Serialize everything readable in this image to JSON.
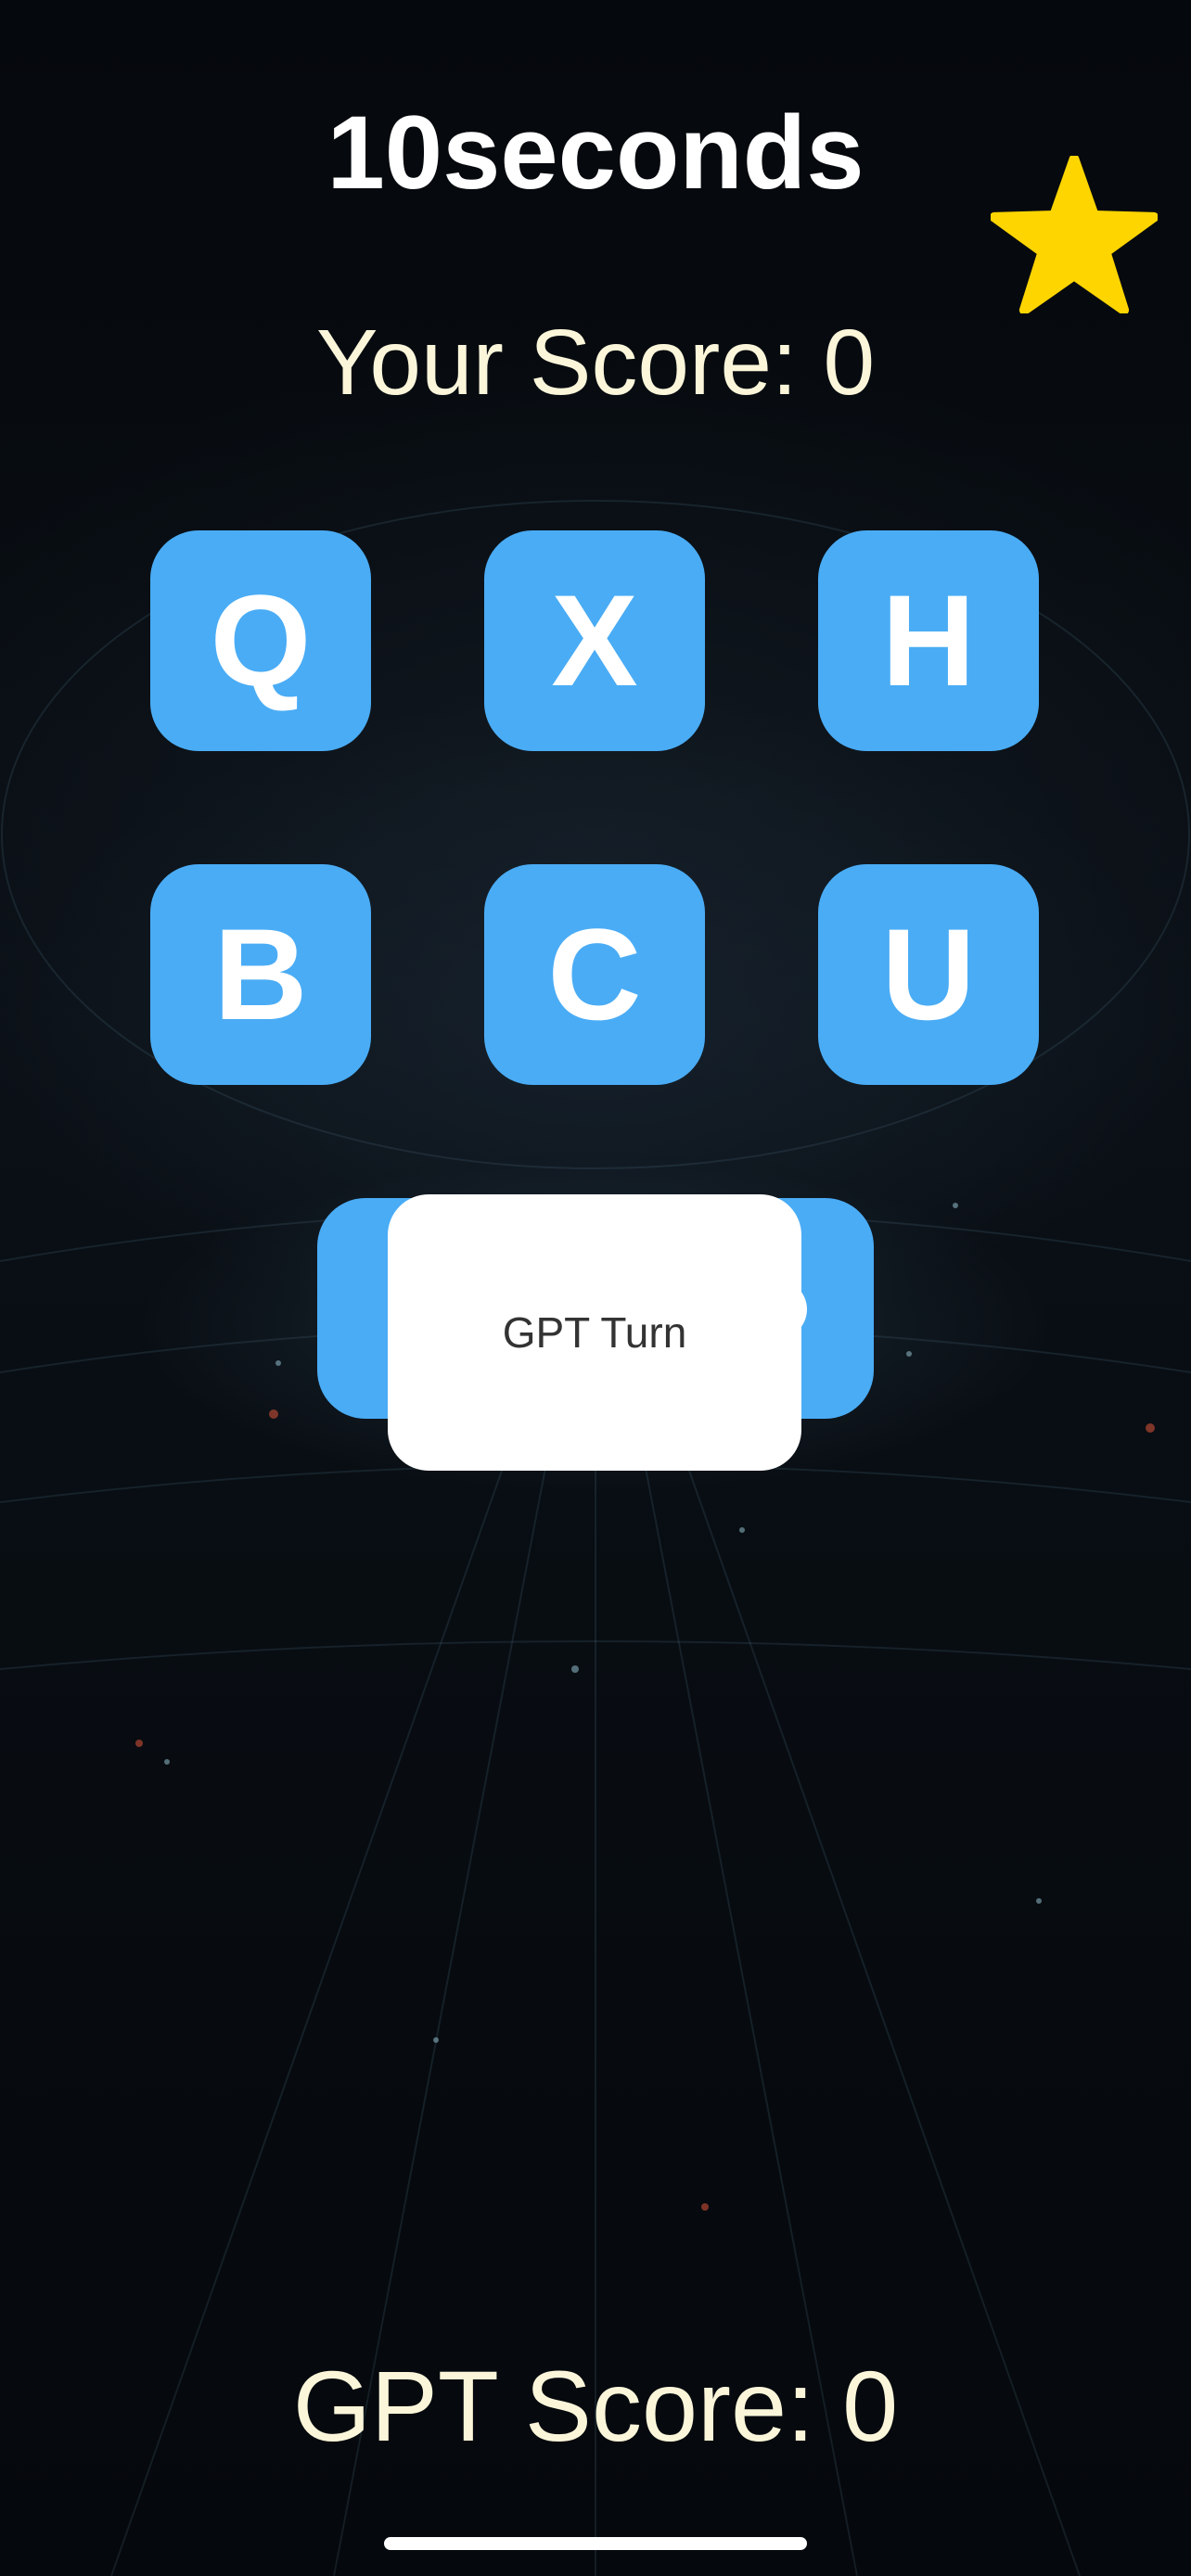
{
  "header": {
    "title": "10seconds"
  },
  "favorite": {
    "icon": "star-icon",
    "color": "#ffd500"
  },
  "score": {
    "player": "Your Score: 0",
    "gpt": "GPT Score: 0"
  },
  "tiles": [
    {
      "letter": "Q"
    },
    {
      "letter": "X"
    },
    {
      "letter": "H"
    },
    {
      "letter": "B"
    },
    {
      "letter": "C"
    },
    {
      "letter": "U"
    }
  ],
  "overlay": {
    "message": "GPT Turn"
  },
  "colors": {
    "tile": "#4aacf5",
    "score_text": "#fbf6da",
    "background": "#05080c"
  }
}
